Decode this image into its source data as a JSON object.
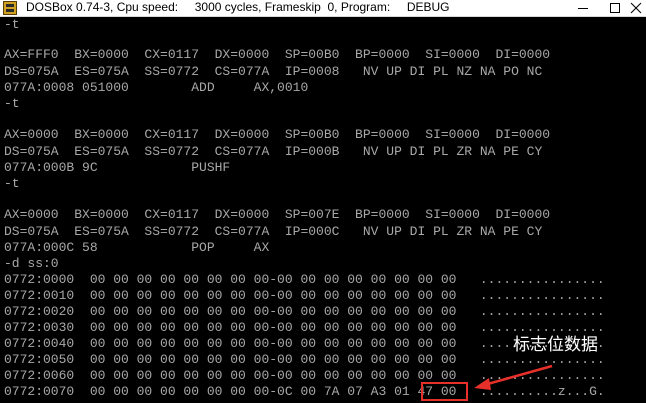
{
  "window": {
    "title": "DOSBox 0.74-3, Cpu speed:     3000 cycles, Frameskip  0, Program:     DEBUG",
    "app_icon": "dosbox-icon",
    "controls": [
      "minimize-icon",
      "maximize-icon",
      "close-icon"
    ]
  },
  "console_lines": [
    "-t",
    "",
    "AX=FFF0  BX=0000  CX=0117  DX=0000  SP=00B0  BP=0000  SI=0000  DI=0000",
    "DS=075A  ES=075A  SS=0772  CS=077A  IP=0008   NV UP DI PL NZ NA PO NC",
    "077A:0008 051000        ADD     AX,0010",
    "-t",
    "",
    "AX=0000  BX=0000  CX=0117  DX=0000  SP=00B0  BP=0000  SI=0000  DI=0000",
    "DS=075A  ES=075A  SS=0772  CS=077A  IP=000B   NV UP DI PL ZR NA PE CY",
    "077A:000B 9C            PUSHF",
    "-t",
    "",
    "AX=0000  BX=0000  CX=0117  DX=0000  SP=007E  BP=0000  SI=0000  DI=0000",
    "DS=075A  ES=075A  SS=0772  CS=077A  IP=000C   NV UP DI PL ZR NA PE CY",
    "077A:000C 58            POP     AX",
    "-d ss:0",
    "0772:0000  00 00 00 00 00 00 00 00-00 00 00 00 00 00 00 00   ................",
    "0772:0010  00 00 00 00 00 00 00 00-00 00 00 00 00 00 00 00   ................",
    "0772:0020  00 00 00 00 00 00 00 00-00 00 00 00 00 00 00 00   ................",
    "0772:0030  00 00 00 00 00 00 00 00-00 00 00 00 00 00 00 00   ................",
    "0772:0040  00 00 00 00 00 00 00 00-00 00 00 00 00 00 00 00   ................",
    "0772:0050  00 00 00 00 00 00 00 00-00 00 00 00 00 00 00 00   ................",
    "0772:0060  00 00 00 00 00 00 00 00-00 00 00 00 00 00 00 00   ................",
    "0772:0070  00 00 00 00 00 00 00 00-0C 00 7A 07 A3 01 47 00   ..........z...G."
  ],
  "annotation": {
    "label": "标志位数据",
    "color": "#e8302a"
  }
}
